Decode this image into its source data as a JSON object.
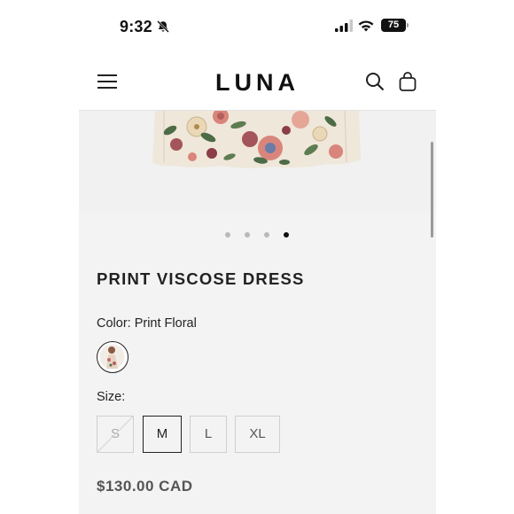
{
  "status_bar": {
    "time": "9:32",
    "battery": "75",
    "icons": [
      "bell-slash-icon",
      "signal-icon",
      "wifi-icon",
      "battery-icon"
    ]
  },
  "header": {
    "brand": "LUNA",
    "icons": [
      "menu-icon",
      "search-icon",
      "bag-icon"
    ]
  },
  "product_image": {
    "carousel_total": 4,
    "carousel_active": 4
  },
  "product": {
    "title": "PRINT VISCOSE DRESS",
    "color_text": "Color: Print Floral",
    "size_label": "Size:",
    "sizes": [
      {
        "label": "S",
        "state": "unavailable"
      },
      {
        "label": "M",
        "state": "selected"
      },
      {
        "label": "L",
        "state": "available"
      },
      {
        "label": "XL",
        "state": "available"
      }
    ],
    "price": "$130.00 CAD"
  },
  "colors": {
    "accent": "#111111",
    "page_bg": "#f3f3f3",
    "floral_pink": "#d9857b",
    "floral_green": "#4d6b46",
    "fabric_cream": "#efe7da"
  }
}
